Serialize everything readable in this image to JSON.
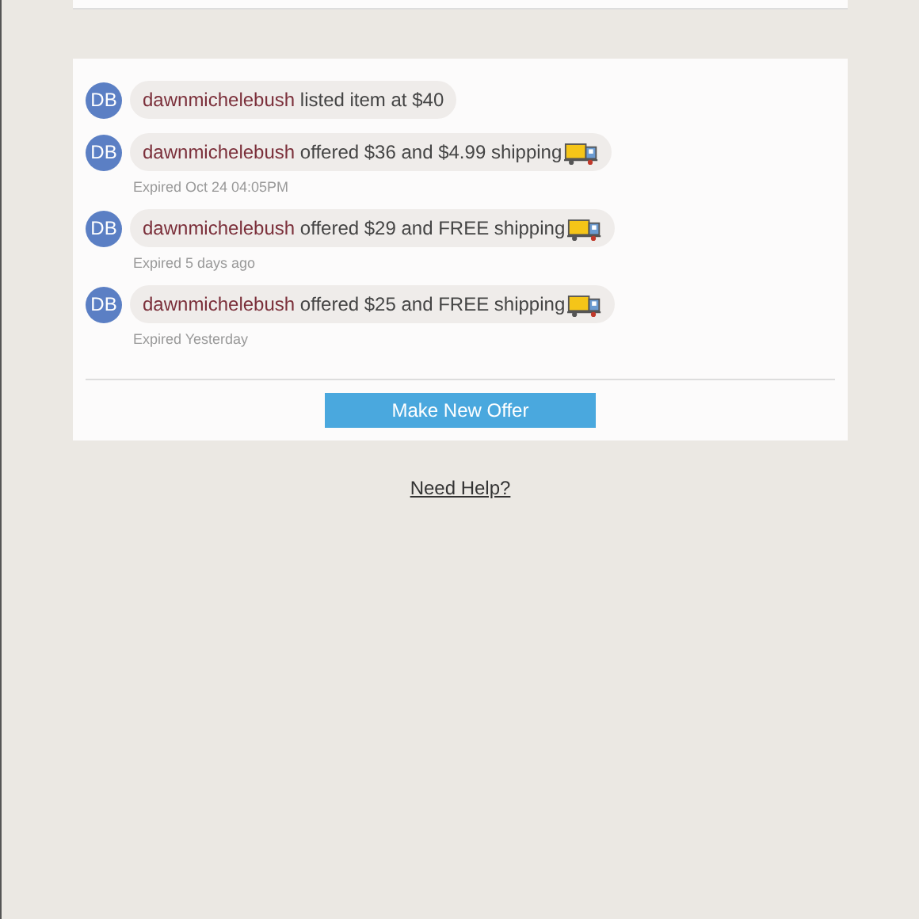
{
  "offers": [
    {
      "avatar": "DB",
      "user": "dawnmichelebush",
      "text": " listed item at $40",
      "shipping_icon": false
    },
    {
      "avatar": "DB",
      "user": "dawnmichelebush",
      "text": " offered $36 and $4.99 shipping",
      "shipping_icon": true,
      "status": "Expired Oct 24 04:05PM"
    },
    {
      "avatar": "DB",
      "user": "dawnmichelebush",
      "text": " offered $29 and FREE shipping",
      "shipping_icon": true,
      "status": "Expired 5 days ago"
    },
    {
      "avatar": "DB",
      "user": "dawnmichelebush",
      "text": " offered $25 and FREE shipping",
      "shipping_icon": true,
      "status": "Expired Yesterday"
    }
  ],
  "button": "Make New Offer",
  "help_link": "Need Help?"
}
